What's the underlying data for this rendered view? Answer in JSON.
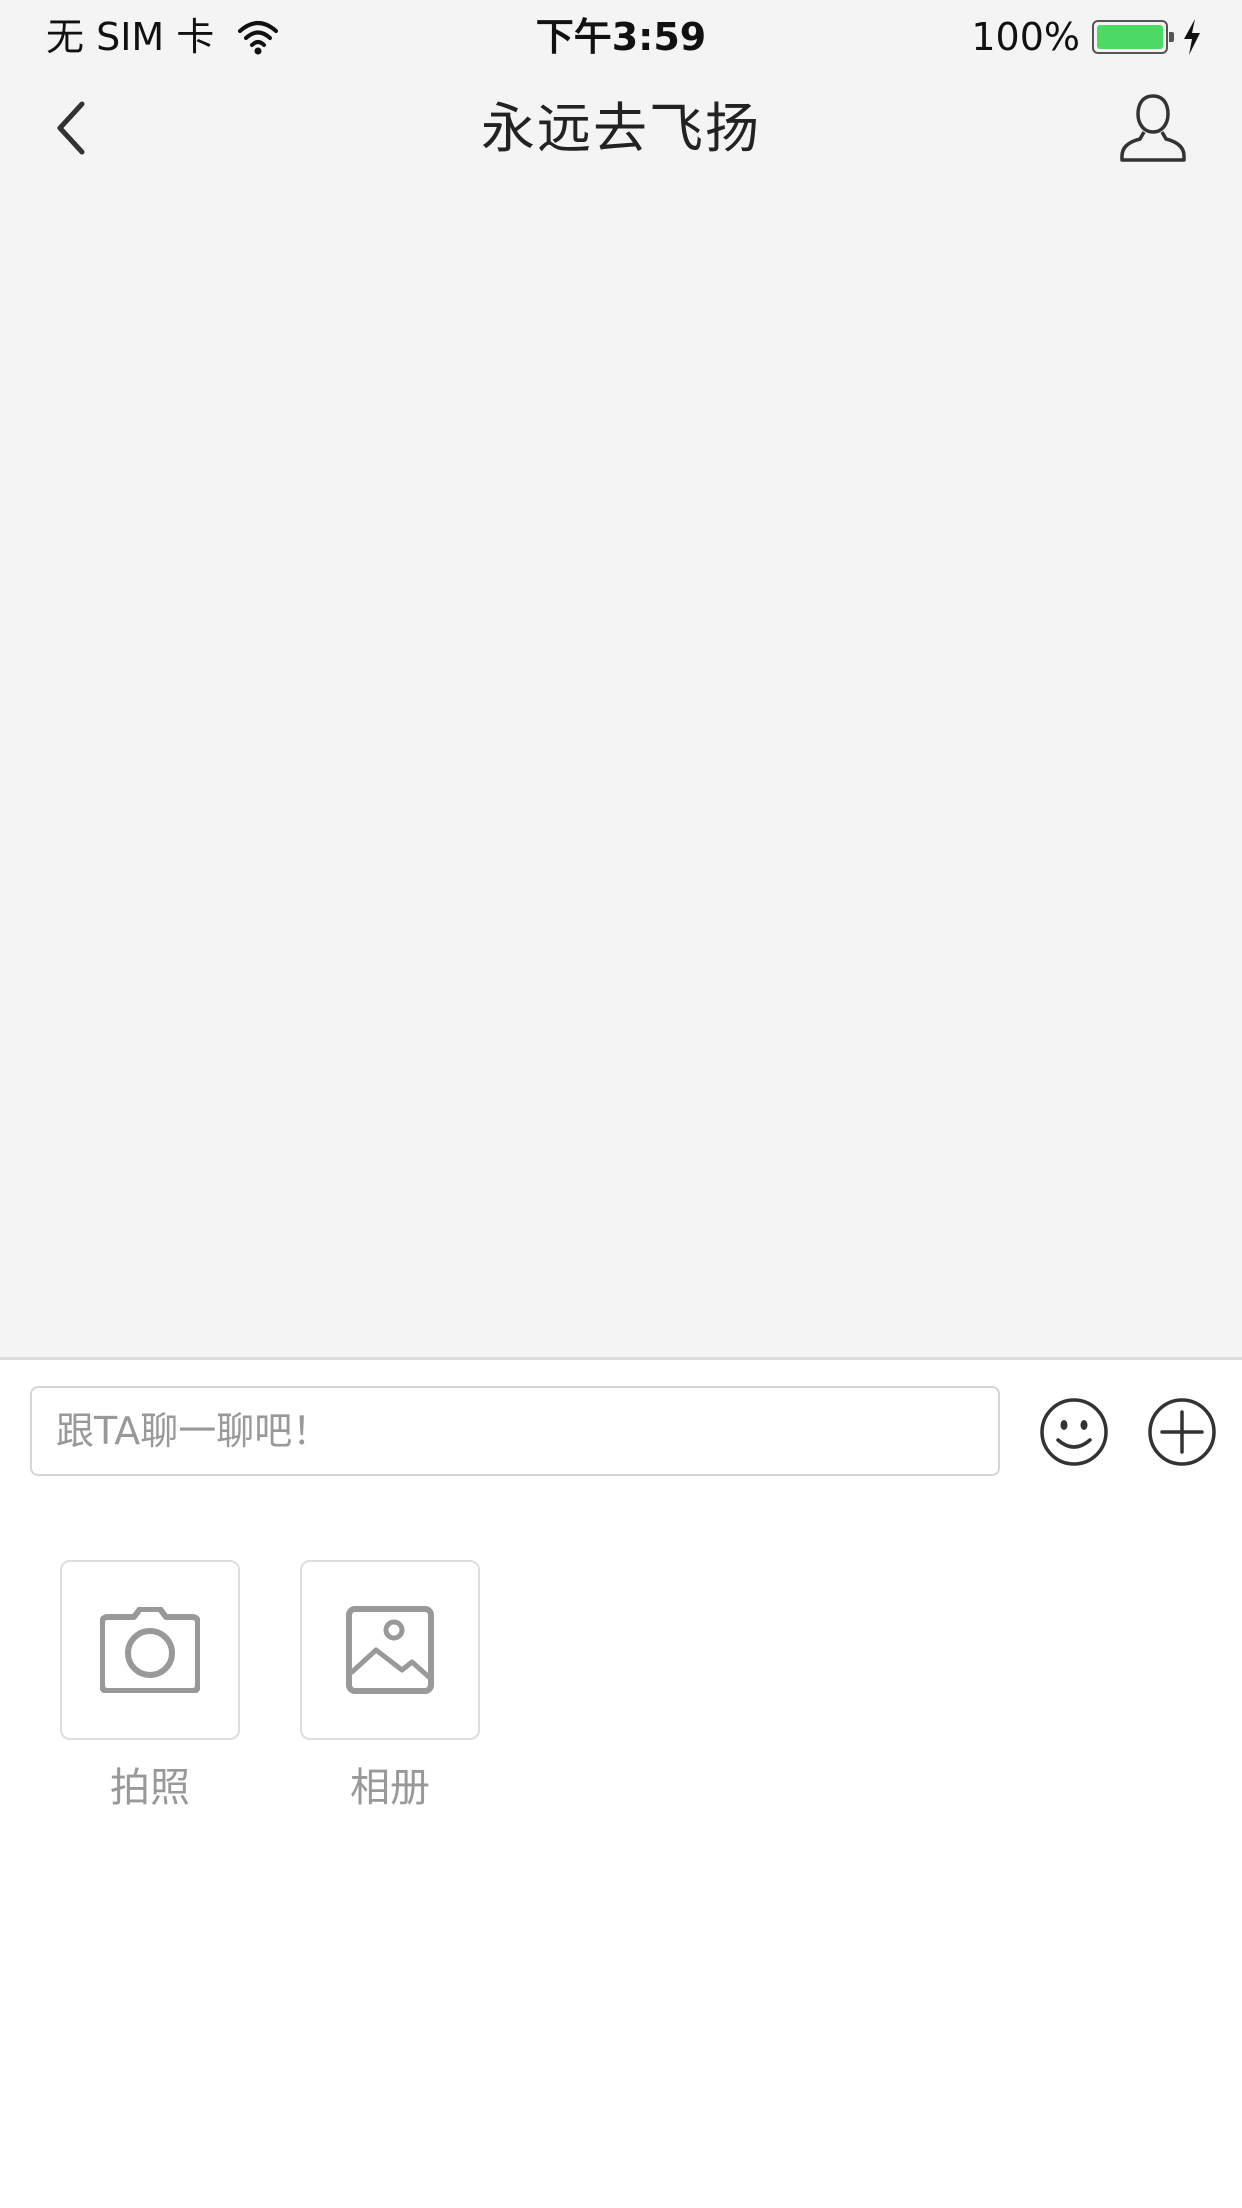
{
  "status_bar": {
    "carrier": "无 SIM 卡",
    "time": "下午3:59",
    "battery": "100%",
    "battery_level": 1.0,
    "battery_color": "#4cd964"
  },
  "nav": {
    "title": "永远去飞扬",
    "back_icon": "chevron-left-icon",
    "profile_icon": "user-profile-icon"
  },
  "composer": {
    "placeholder": "跟TA聊一聊吧！",
    "emoji_icon": "smiley-icon",
    "plus_icon": "plus-circle-icon"
  },
  "attachments": [
    {
      "label": "拍照",
      "icon": "camera-icon"
    },
    {
      "label": "相册",
      "icon": "photo-album-icon"
    }
  ],
  "colors": {
    "background": "#f4f4f4",
    "panel": "#ffffff",
    "icon_gray": "#999999",
    "text_dark": "#222222"
  }
}
